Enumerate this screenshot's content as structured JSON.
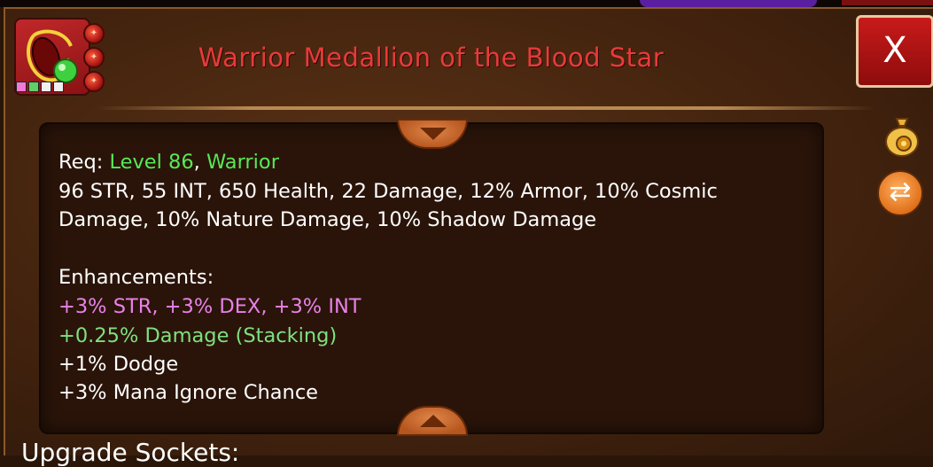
{
  "item": {
    "title": "Warrior Medallion of the Blood Star",
    "icon": "blood-star-medallion-icon",
    "rarity_colors": [
      "#f07ad8",
      "#5fd06a",
      "#f0f0f0",
      "#f0f0f0"
    ]
  },
  "close_button": {
    "label": "X"
  },
  "requirements": {
    "prefix": "Req: ",
    "level": "Level 86",
    "separator": ", ",
    "class": "Warrior"
  },
  "stats": {
    "line1": "96 STR, 55 INT, 650 Health, 22 Damage, 12% Armor, 10% Cosmic",
    "line2": "Damage, 10% Nature Damage, 10% Shadow Damage"
  },
  "enhancements": {
    "header": "Enhancements:",
    "lines": [
      "+3% STR, +3% DEX, +3% INT",
      "+0.25% Damage (Stacking)",
      "+1% Dodge",
      "+3% Mana Ignore Chance"
    ]
  },
  "upgrade_sockets": {
    "label": "Upgrade Sockets:"
  },
  "side_buttons": {
    "bag": "gold-bag-icon",
    "swap": "swap-arrows-icon"
  },
  "colors": {
    "title": "#e83a3a",
    "level_class": "#58e858",
    "enh_primary": "#e882e8",
    "enh_secondary": "#7fe07f"
  }
}
